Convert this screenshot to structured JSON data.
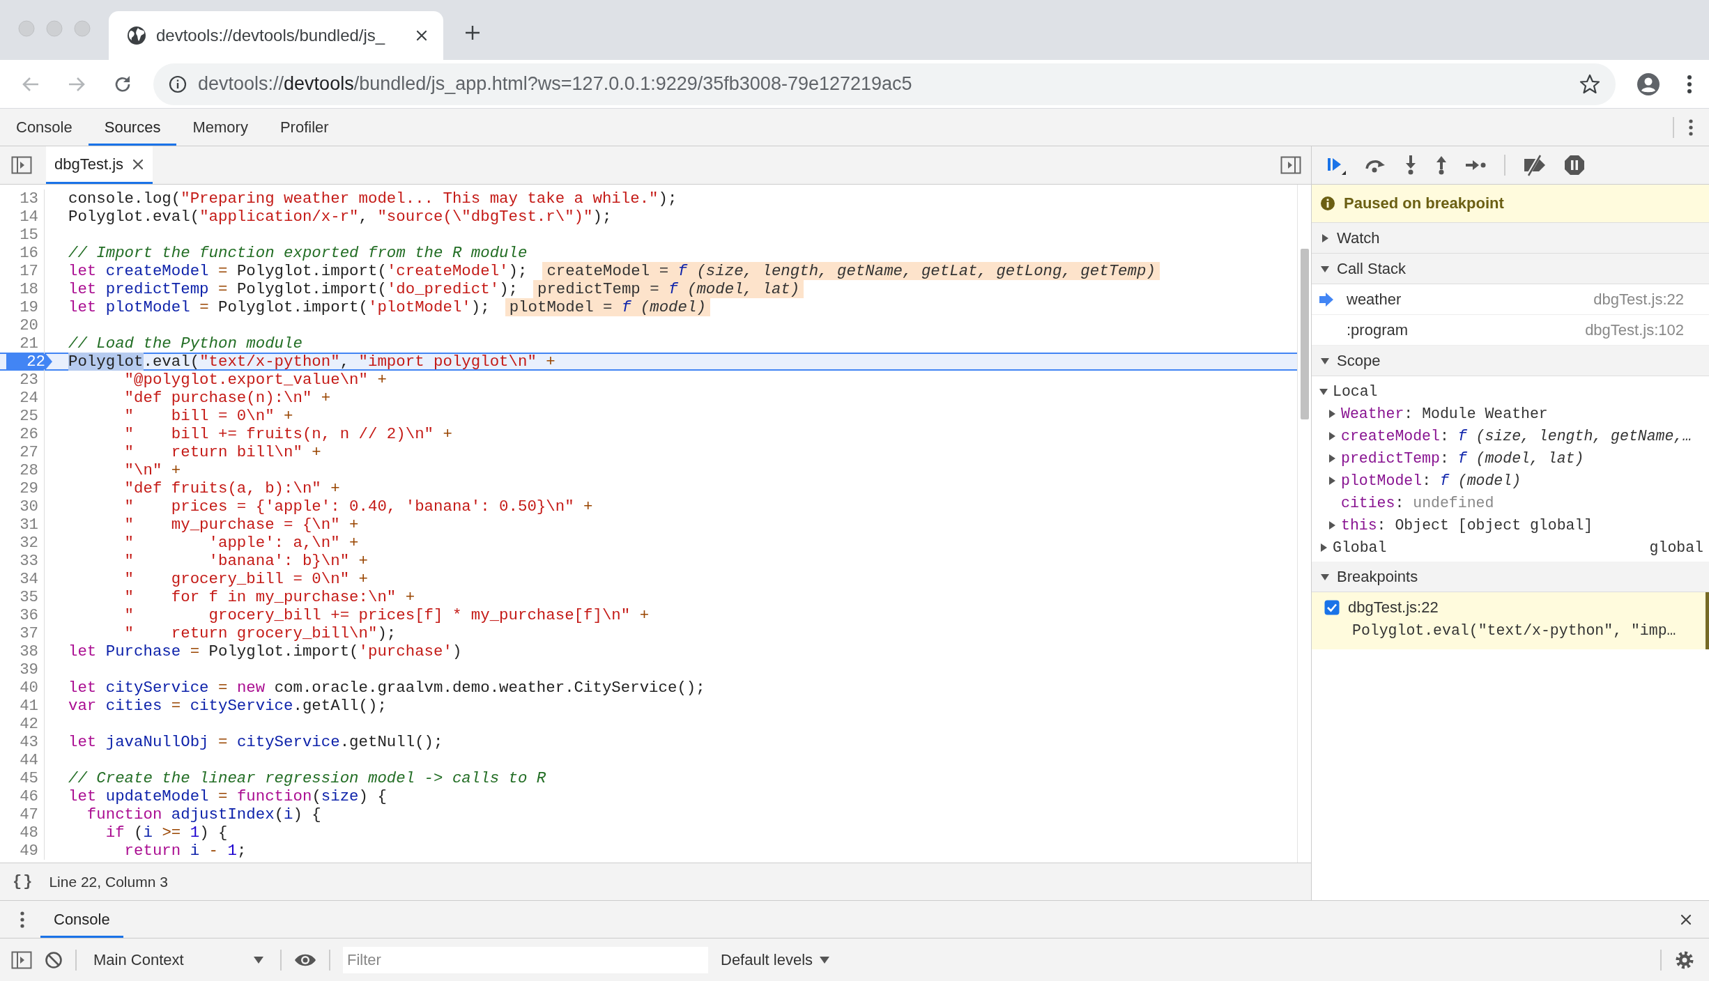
{
  "browser": {
    "tab_title": "devtools://devtools/bundled/js_",
    "url": {
      "scheme": "devtools://",
      "host": "devtools",
      "path": "/bundled/js_app.html?ws=127.0.0.1:9229/35fb3008-79e127219ac5"
    }
  },
  "devtools_tabs": [
    {
      "label": "Console",
      "selected": false
    },
    {
      "label": "Sources",
      "selected": true
    },
    {
      "label": "Memory",
      "selected": false
    },
    {
      "label": "Profiler",
      "selected": false
    }
  ],
  "editor": {
    "file_tab": "dbgTest.js",
    "lines": [
      {
        "number": "13",
        "breakpoint": false,
        "current": false,
        "tokens": [
          {
            "kind": "plain",
            "text": "console.log("
          },
          {
            "kind": "string",
            "text": "\"Preparing weather model... This may take a while.\""
          },
          {
            "kind": "plain",
            "text": ");"
          }
        ]
      },
      {
        "number": "14",
        "breakpoint": false,
        "current": false,
        "tokens": [
          {
            "kind": "plain",
            "text": "Polyglot.eval("
          },
          {
            "kind": "string",
            "text": "\"application/x-r\""
          },
          {
            "kind": "plain",
            "text": ", "
          },
          {
            "kind": "string",
            "text": "\"source(\\\"dbgTest.r\\\")\""
          },
          {
            "kind": "plain",
            "text": ");"
          }
        ]
      },
      {
        "number": "15",
        "breakpoint": false,
        "current": false
      },
      {
        "number": "16",
        "breakpoint": false,
        "current": false,
        "tokens": [
          {
            "kind": "comment",
            "text": "// Import the function exported from the R module"
          }
        ]
      },
      {
        "number": "17",
        "breakpoint": false,
        "current": false,
        "tokens": [
          {
            "kind": "keyword",
            "text": "let "
          },
          {
            "kind": "name",
            "text": "createModel "
          },
          {
            "kind": "operator",
            "text": "= "
          },
          {
            "kind": "plain",
            "text": "Polyglot.import("
          },
          {
            "kind": "string",
            "text": "'createModel'"
          },
          {
            "kind": "plain",
            "text": ");"
          }
        ],
        "inline_value": {
          "name": "createModel",
          "operator": "=",
          "marker": "f",
          "signature": "(size, length, getName, getLat, getLong, getTemp)"
        }
      },
      {
        "number": "18",
        "breakpoint": false,
        "current": false,
        "tokens": [
          {
            "kind": "keyword",
            "text": "let "
          },
          {
            "kind": "name",
            "text": "predictTemp "
          },
          {
            "kind": "operator",
            "text": "= "
          },
          {
            "kind": "plain",
            "text": "Polyglot.import("
          },
          {
            "kind": "string",
            "text": "'do_predict'"
          },
          {
            "kind": "plain",
            "text": ");"
          }
        ],
        "inline_value": {
          "name": "predictTemp",
          "operator": "=",
          "marker": "f",
          "signature": "(model, lat)"
        }
      },
      {
        "number": "19",
        "breakpoint": false,
        "current": false,
        "tokens": [
          {
            "kind": "keyword",
            "text": "let "
          },
          {
            "kind": "name",
            "text": "plotModel "
          },
          {
            "kind": "operator",
            "text": "= "
          },
          {
            "kind": "plain",
            "text": "Polyglot.import("
          },
          {
            "kind": "string",
            "text": "'plotModel'"
          },
          {
            "kind": "plain",
            "text": ");"
          }
        ],
        "inline_value": {
          "name": "plotModel",
          "operator": "=",
          "marker": "f",
          "signature": "(model)"
        }
      },
      {
        "number": "20",
        "breakpoint": false,
        "current": false
      },
      {
        "number": "21",
        "breakpoint": false,
        "current": false,
        "tokens": [
          {
            "kind": "comment",
            "text": "// Load the Python module"
          }
        ]
      },
      {
        "number": "22",
        "breakpoint": true,
        "current": true,
        "tokens": [
          {
            "kind": "selection",
            "text": "Polyglot"
          },
          {
            "kind": "plain",
            "text": ".eval("
          },
          {
            "kind": "string",
            "text": "\"text/x-python\""
          },
          {
            "kind": "plain",
            "text": ", "
          },
          {
            "kind": "string",
            "text": "\"import polyglot\\n\" "
          },
          {
            "kind": "operator",
            "text": "+"
          }
        ]
      },
      {
        "number": "23",
        "breakpoint": false,
        "current": false,
        "tokens": [
          {
            "kind": "string",
            "text": "      \"@polyglot.export_value\\n\" "
          },
          {
            "kind": "operator",
            "text": "+"
          }
        ]
      },
      {
        "number": "24",
        "breakpoint": false,
        "current": false,
        "tokens": [
          {
            "kind": "string",
            "text": "      \"def purchase(n):\\n\" "
          },
          {
            "kind": "operator",
            "text": "+"
          }
        ]
      },
      {
        "number": "25",
        "breakpoint": false,
        "current": false,
        "tokens": [
          {
            "kind": "string",
            "text": "      \"    bill = 0\\n\" "
          },
          {
            "kind": "operator",
            "text": "+"
          }
        ]
      },
      {
        "number": "26",
        "breakpoint": false,
        "current": false,
        "tokens": [
          {
            "kind": "string",
            "text": "      \"    bill += fruits(n, n // 2)\\n\" "
          },
          {
            "kind": "operator",
            "text": "+"
          }
        ]
      },
      {
        "number": "27",
        "breakpoint": false,
        "current": false,
        "tokens": [
          {
            "kind": "string",
            "text": "      \"    return bill\\n\" "
          },
          {
            "kind": "operator",
            "text": "+"
          }
        ]
      },
      {
        "number": "28",
        "breakpoint": false,
        "current": false,
        "tokens": [
          {
            "kind": "string",
            "text": "      \"\\n\" "
          },
          {
            "kind": "operator",
            "text": "+"
          }
        ]
      },
      {
        "number": "29",
        "breakpoint": false,
        "current": false,
        "tokens": [
          {
            "kind": "string",
            "text": "      \"def fruits(a, b):\\n\" "
          },
          {
            "kind": "operator",
            "text": "+"
          }
        ]
      },
      {
        "number": "30",
        "breakpoint": false,
        "current": false,
        "tokens": [
          {
            "kind": "string",
            "text": "      \"    prices = {'apple': 0.40, 'banana': 0.50}\\n\" "
          },
          {
            "kind": "operator",
            "text": "+"
          }
        ]
      },
      {
        "number": "31",
        "breakpoint": false,
        "current": false,
        "tokens": [
          {
            "kind": "string",
            "text": "      \"    my_purchase = {\\n\" "
          },
          {
            "kind": "operator",
            "text": "+"
          }
        ]
      },
      {
        "number": "32",
        "breakpoint": false,
        "current": false,
        "tokens": [
          {
            "kind": "string",
            "text": "      \"        'apple': a,\\n\" "
          },
          {
            "kind": "operator",
            "text": "+"
          }
        ]
      },
      {
        "number": "33",
        "breakpoint": false,
        "current": false,
        "tokens": [
          {
            "kind": "string",
            "text": "      \"        'banana': b}\\n\" "
          },
          {
            "kind": "operator",
            "text": "+"
          }
        ]
      },
      {
        "number": "34",
        "breakpoint": false,
        "current": false,
        "tokens": [
          {
            "kind": "string",
            "text": "      \"    grocery_bill = 0\\n\" "
          },
          {
            "kind": "operator",
            "text": "+"
          }
        ]
      },
      {
        "number": "35",
        "breakpoint": false,
        "current": false,
        "tokens": [
          {
            "kind": "string",
            "text": "      \"    for f in my_purchase:\\n\" "
          },
          {
            "kind": "operator",
            "text": "+"
          }
        ]
      },
      {
        "number": "36",
        "breakpoint": false,
        "current": false,
        "tokens": [
          {
            "kind": "string",
            "text": "      \"        grocery_bill += prices[f] * my_purchase[f]\\n\" "
          },
          {
            "kind": "operator",
            "text": "+"
          }
        ]
      },
      {
        "number": "37",
        "breakpoint": false,
        "current": false,
        "tokens": [
          {
            "kind": "string",
            "text": "      \"    return grocery_bill\\n\""
          },
          {
            "kind": "plain",
            "text": ");"
          }
        ]
      },
      {
        "number": "38",
        "breakpoint": false,
        "current": false,
        "tokens": [
          {
            "kind": "keyword",
            "text": "let "
          },
          {
            "kind": "name",
            "text": "Purchase "
          },
          {
            "kind": "operator",
            "text": "= "
          },
          {
            "kind": "plain",
            "text": "Polyglot.import("
          },
          {
            "kind": "string",
            "text": "'purchase'"
          },
          {
            "kind": "plain",
            "text": ")"
          }
        ]
      },
      {
        "number": "39",
        "breakpoint": false,
        "current": false
      },
      {
        "number": "40",
        "breakpoint": false,
        "current": false,
        "tokens": [
          {
            "kind": "keyword",
            "text": "let "
          },
          {
            "kind": "name",
            "text": "cityService "
          },
          {
            "kind": "operator",
            "text": "= "
          },
          {
            "kind": "keyword",
            "text": "new "
          },
          {
            "kind": "plain",
            "text": "com.oracle.graalvm.demo.weather.CityService();"
          }
        ]
      },
      {
        "number": "41",
        "breakpoint": false,
        "current": false,
        "tokens": [
          {
            "kind": "keyword",
            "text": "var "
          },
          {
            "kind": "name",
            "text": "cities "
          },
          {
            "kind": "operator",
            "text": "= "
          },
          {
            "kind": "name",
            "text": "cityService"
          },
          {
            "kind": "plain",
            "text": ".getAll();"
          }
        ]
      },
      {
        "number": "42",
        "breakpoint": false,
        "current": false
      },
      {
        "number": "43",
        "breakpoint": false,
        "current": false,
        "tokens": [
          {
            "kind": "keyword",
            "text": "let "
          },
          {
            "kind": "name",
            "text": "javaNullObj "
          },
          {
            "kind": "operator",
            "text": "= "
          },
          {
            "kind": "name",
            "text": "cityService"
          },
          {
            "kind": "plain",
            "text": ".getNull();"
          }
        ]
      },
      {
        "number": "44",
        "breakpoint": false,
        "current": false
      },
      {
        "number": "45",
        "breakpoint": false,
        "current": false,
        "tokens": [
          {
            "kind": "comment",
            "text": "// Create the linear regression model -> calls to R"
          }
        ]
      },
      {
        "number": "46",
        "breakpoint": false,
        "current": false,
        "tokens": [
          {
            "kind": "keyword",
            "text": "let "
          },
          {
            "kind": "name",
            "text": "updateModel "
          },
          {
            "kind": "operator",
            "text": "= "
          },
          {
            "kind": "keyword",
            "text": "function"
          },
          {
            "kind": "plain",
            "text": "("
          },
          {
            "kind": "name",
            "text": "size"
          },
          {
            "kind": "plain",
            "text": ") {"
          }
        ]
      },
      {
        "number": "47",
        "breakpoint": false,
        "current": false,
        "tokens": [
          {
            "kind": "keyword",
            "text": "  function "
          },
          {
            "kind": "name",
            "text": "adjustIndex"
          },
          {
            "kind": "plain",
            "text": "("
          },
          {
            "kind": "name",
            "text": "i"
          },
          {
            "kind": "plain",
            "text": ") {"
          }
        ]
      },
      {
        "number": "48",
        "breakpoint": false,
        "current": false,
        "tokens": [
          {
            "kind": "keyword",
            "text": "    if "
          },
          {
            "kind": "plain",
            "text": "("
          },
          {
            "kind": "name",
            "text": "i "
          },
          {
            "kind": "operator",
            "text": ">= "
          },
          {
            "kind": "number",
            "text": "1"
          },
          {
            "kind": "plain",
            "text": ") {"
          }
        ]
      },
      {
        "number": "49",
        "breakpoint": false,
        "current": false,
        "tokens": [
          {
            "kind": "keyword",
            "text": "      return "
          },
          {
            "kind": "name",
            "text": "i "
          },
          {
            "kind": "operator",
            "text": "- "
          },
          {
            "kind": "number",
            "text": "1"
          },
          {
            "kind": "plain",
            "text": ";"
          }
        ]
      }
    ],
    "format_button": "{}",
    "status": "Line 22, Column 3"
  },
  "debugger": {
    "paused_message": "Paused on breakpoint",
    "watch": {
      "title": "Watch",
      "expanded": false
    },
    "call_stack": {
      "title": "Call Stack",
      "expanded": true,
      "frames": [
        {
          "name": "weather",
          "location": "dbgTest.js:22",
          "selected": true
        },
        {
          "name": ":program",
          "location": "dbgTest.js:102",
          "selected": false
        }
      ]
    },
    "scope": {
      "title": "Scope",
      "expanded": true,
      "groups": [
        {
          "name": "Local",
          "expanded": true,
          "children": [
            {
              "name": "Weather",
              "separator": ":",
              "kind": "object",
              "value": "Module Weather",
              "expandable": true
            },
            {
              "name": "createModel",
              "separator": ":",
              "kind": "function",
              "marker": "f",
              "value": "(size, length, getName,…",
              "expandable": true
            },
            {
              "name": "predictTemp",
              "separator": ":",
              "kind": "function",
              "marker": "f",
              "value": "(model, lat)",
              "expandable": true
            },
            {
              "name": "plotModel",
              "separator": ":",
              "kind": "function",
              "marker": "f",
              "value": "(model)",
              "expandable": true
            },
            {
              "name": "cities",
              "separator": ":",
              "kind": "undefined",
              "value": "undefined",
              "expandable": false
            },
            {
              "name": "this",
              "separator": ":",
              "kind": "object",
              "value": "Object [object global]",
              "expandable": true
            }
          ]
        },
        {
          "name": "Global",
          "expanded": false,
          "value": "global"
        }
      ]
    },
    "breakpoints": {
      "title": "Breakpoints",
      "expanded": true,
      "items": [
        {
          "location": "dbgTest.js:22",
          "code": "Polyglot.eval(\"text/x-python\", \"imp…",
          "checked": true
        }
      ]
    }
  },
  "console": {
    "tab": {
      "label": "Console",
      "selected": true
    },
    "context": "Main Context",
    "filter_placeholder": "Filter",
    "levels": "Default levels"
  }
}
